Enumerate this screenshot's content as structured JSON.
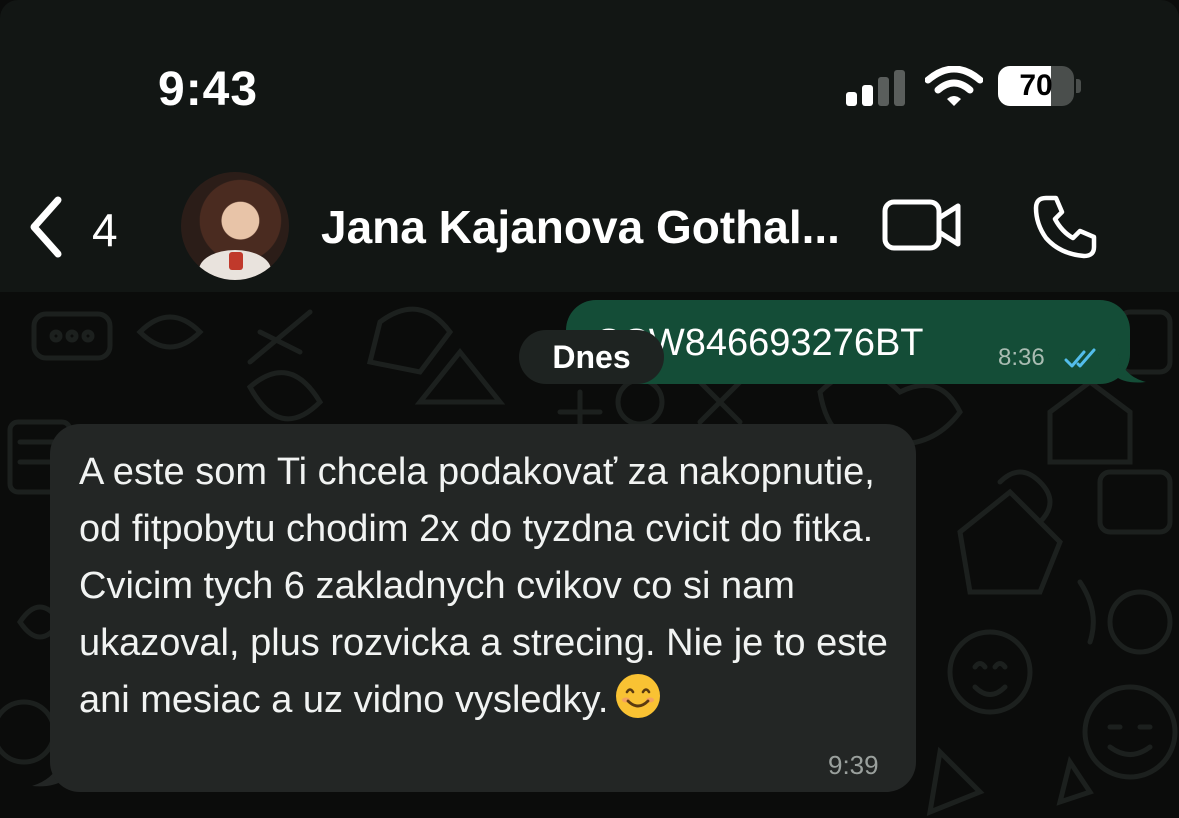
{
  "status_bar": {
    "time": "9:43",
    "battery_percent": "70",
    "battery_level": 0.7,
    "signal_bars_active": 2,
    "signal_bars_total": 4,
    "wifi_icon": "wifi-icon"
  },
  "header": {
    "back_count": "4",
    "contact_name": "Jana Kajanova Gothal...",
    "icons": [
      "chevron-left-icon",
      "video-camera-icon",
      "phone-icon"
    ]
  },
  "chat": {
    "date_separator": "Dnes",
    "messages": [
      {
        "direction": "outgoing",
        "text": "CCW846693276BT",
        "time": "8:36",
        "status_icon": "double-check-icon",
        "status_color": "#53bdeb"
      },
      {
        "direction": "incoming",
        "text": "A este som Ti chcela podakovať za nakopnutie, od fitpobytu chodim 2x do tyzdna cvicit do fitka. Cvicim tych 6 zakladnych cvikov co si nam ukazoval, plus rozvicka a strecing. Nie je to este ani mesiac a uz vidno vysledky.",
        "emoji": "smiling-face-emoji",
        "time": "9:39"
      }
    ]
  },
  "colors": {
    "header_bg": "#121614",
    "chat_bg": "#0b0c0b",
    "outgoing_bubble": "#144d37",
    "incoming_bubble": "#232625",
    "date_pill": "#1e2321"
  }
}
